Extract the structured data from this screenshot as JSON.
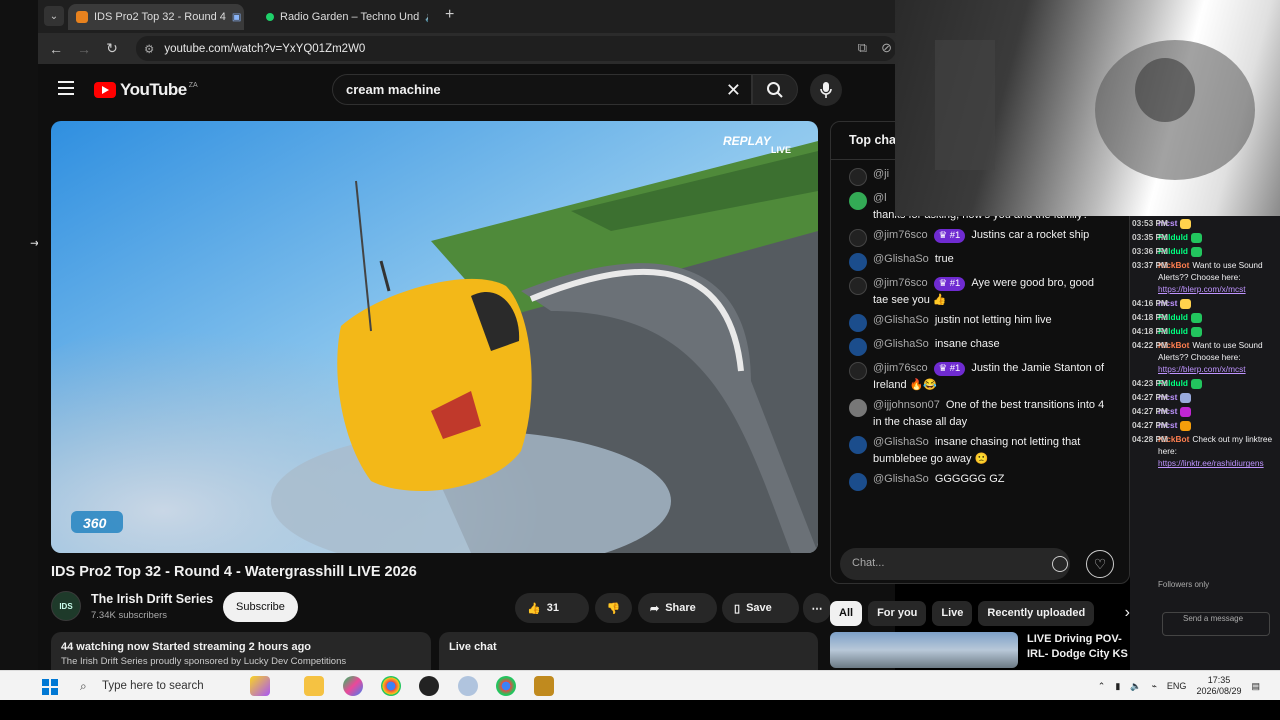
{
  "browser": {
    "tabs": [
      {
        "label": "IDS Pro2 Top 32 - Round 4",
        "active": true
      },
      {
        "label": "Radio Garden – Techno Und",
        "active": false
      }
    ],
    "url": "youtube.com/watch?v=YxYQ01Zm2W0"
  },
  "youtube": {
    "logo_text": "YouTube",
    "country_code": "ZA",
    "search_query": "cream machine",
    "video": {
      "title": "IDS Pro2 Top 32 - Round 4 - Watergrasshill LIVE 2026",
      "overlay_brand": "REPLAY",
      "overlay_live": "LIVE",
      "corner_logo": "360"
    },
    "channel": {
      "name": "The Irish Drift Series",
      "subscribers": "7.34K subscribers",
      "subscribe_label": "Subscribe"
    },
    "actions": {
      "likes": "31",
      "share": "Share",
      "save": "Save"
    },
    "description": {
      "watching_now": "44",
      "watching_suffix": " watching now  Started streaming 2 hours ago",
      "snippet": "The Irish Drift Series proudly sponsored by Lucky Dev Competitions"
    },
    "live_chat_button": "Live chat",
    "chat": {
      "header": "Top chat",
      "messages": [
        {
          "author": "@ji",
          "badge": "",
          "text": ""
        },
        {
          "author": "@l",
          "badge": "",
          "text": "thanks for asking, how's you and the family?"
        },
        {
          "author": "@jim76sco",
          "badge": "#1",
          "text": "Justins car a rocket ship"
        },
        {
          "author": "@GlishaSo",
          "badge": "",
          "text": "true"
        },
        {
          "author": "@jim76sco",
          "badge": "#1",
          "text": "Aye were good bro, good tae see you 👍"
        },
        {
          "author": "@GlishaSo",
          "badge": "",
          "text": "justin not letting him live"
        },
        {
          "author": "@GlishaSo",
          "badge": "",
          "text": "insane chase"
        },
        {
          "author": "@jim76sco",
          "badge": "#1",
          "text": "Justin the Jamie Stanton of Ireland 🔥😂"
        },
        {
          "author": "@ijjohnson07",
          "badge": "",
          "text": "One of the best transitions into 4 in the chase all day"
        },
        {
          "author": "@GlishaSo",
          "badge": "",
          "text": "insane chasing not letting that bumblebee go away 🙁"
        },
        {
          "author": "@GlishaSo",
          "badge": "",
          "text": "GGGGGG GZ"
        }
      ],
      "input_placeholder": "Chat..."
    },
    "chips": [
      "All",
      "For you",
      "Live",
      "Recently uploaded"
    ],
    "recommendation": {
      "title": "LIVE Driving POV- IRL- Dodge City KS"
    }
  },
  "twitch_chat": {
    "messages": [
      {
        "time": "03:53 PM",
        "user": "mcst",
        "user_color": "#bf94ff",
        "text": ""
      },
      {
        "time": "03:35 PM",
        "user": "Fulduld",
        "user_color": "#00ff7f",
        "text": ""
      },
      {
        "time": "03:36 PM",
        "user": "Fulduld",
        "user_color": "#00ff7f",
        "text": ""
      },
      {
        "time": "03:37 PM",
        "user": "KickBot",
        "user_color": "#ff7f50",
        "text": "Want to use Sound Alerts?? Choose here:",
        "link": "https://blerp.com/x/mcst"
      },
      {
        "time": "04:16 PM",
        "user": "mcst",
        "user_color": "#bf94ff",
        "text": ""
      },
      {
        "time": "04:18 PM",
        "user": "Fulduld",
        "user_color": "#00ff7f",
        "text": ""
      },
      {
        "time": "04:18 PM",
        "user": "Fulduld",
        "user_color": "#00ff7f",
        "text": ""
      },
      {
        "time": "04:22 PM",
        "user": "KickBot",
        "user_color": "#ff7f50",
        "text": "Want to use Sound Alerts?? Choose here:",
        "link": "https://blerp.com/x/mcst"
      },
      {
        "time": "04:23 PM",
        "user": "Fulduld",
        "user_color": "#00ff7f",
        "text": ""
      },
      {
        "time": "04:27 PM",
        "user": "mcst",
        "user_color": "#bf94ff",
        "text": ""
      },
      {
        "time": "04:27 PM",
        "user": "mcst",
        "user_color": "#bf94ff",
        "text": ""
      },
      {
        "time": "04:27 PM",
        "user": "mcst",
        "user_color": "#bf94ff",
        "text": ""
      },
      {
        "time": "04:28 PM",
        "user": "KickBot",
        "user_color": "#ff7f50",
        "text": "Check out my linktree here:",
        "link": "https://linktr.ee/rashidiurgens"
      }
    ],
    "followers_only": "Followers only",
    "send_placeholder": "Send a message"
  },
  "taskbar": {
    "search_placeholder": "Type here to search",
    "language": "ENG",
    "time": "17:35",
    "date": "2026/08/29"
  },
  "colors": {
    "youtube_red": "#ff0000",
    "badge_purple": "#6f2bd1",
    "twitch_bg": "#18181b"
  }
}
